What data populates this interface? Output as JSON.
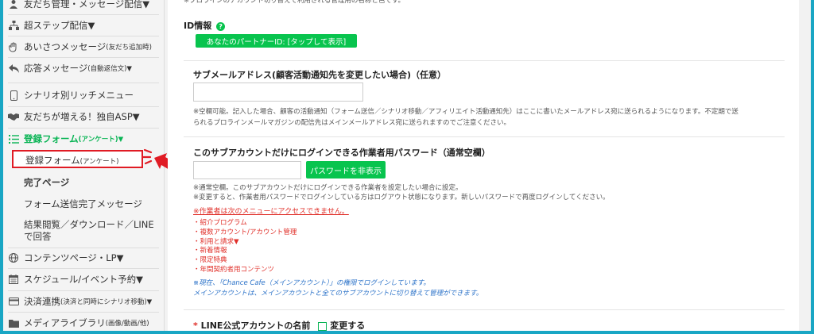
{
  "sidebar": {
    "items": [
      {
        "label": "友だち管理・メッセージ配信▼",
        "icon": "person-icon"
      },
      {
        "label": "超ステップ配信▼",
        "icon": "sitemap-icon"
      },
      {
        "label": "あいさつメッセージ",
        "small": "(友だち追加時)",
        "icon": "hand-icon"
      },
      {
        "label": "応答メッセージ",
        "small": "(自動返信文)▼",
        "icon": "reply-icon"
      },
      {
        "label": "シナリオ別リッチメニュー",
        "icon": "mobile-icon"
      },
      {
        "label": "友だちが増える！独自ASP▼",
        "icon": "handshake-icon"
      },
      {
        "label": "登録フォーム",
        "small": "(アンケート)▼",
        "icon": "list-icon"
      }
    ],
    "sub_items": [
      {
        "label": "登録フォーム",
        "small": "(アンケート)"
      },
      {
        "label": "完了ページ"
      },
      {
        "label": "フォーム送信完了メッセージ"
      },
      {
        "label_line1": "結果閲覧／ダウンロード／LINE",
        "label_line2": "で回答"
      }
    ],
    "bottom_items": [
      {
        "label": "コンテンツページ・LP▼",
        "icon": "globe-icon"
      },
      {
        "label": "スケジュール/イベント予約▼",
        "icon": "calendar-icon"
      },
      {
        "label": "決済連携",
        "small": "(決済と同時にシナリオ移動)▼",
        "icon": "card-icon"
      },
      {
        "label": "メディアライブラリ",
        "small": "(画像/動画/他)",
        "icon": "folder-icon"
      }
    ]
  },
  "content": {
    "top_note": "※プロラインのアカウント切り替えで利用される管理用の名称と色です。",
    "id_section": {
      "title": "ID情報",
      "help_icon": "question-icon",
      "button": "あなたのパートナーID: [タップして表示]"
    },
    "sub_email": {
      "title": "サブメールアドレス(顧客活動通知先を変更したい場合)（任意）",
      "note_line1": "※空欄可能。記入した場合、顧客の活動通知（フォーム送信／シナリオ移動／アフィリエイト活動通知先）はここに書いたメールアドレス宛に送られるようになります。不定期で送",
      "note_line2": "られるプロラインメールマガジンの配信先はメインメールアドレス宛に送られますのでご注意ください。"
    },
    "password": {
      "title": "このサブアカウントだけにログインできる作業者用パスワード（通常空欄）",
      "hide_button": "パスワードを非表示",
      "note_line1": "※通常空欄。このサブアカウントだけにログインできる作業者を設定したい場合に設定。",
      "note_line2": "※変更すると、作業者用パスワードでログインしている方はログアウト状態になります。新しいパスワードで再度ログインしてください。",
      "warning": "※作業者は次のメニューにアクセスできません。",
      "restricted": [
        "・紹介プログラム",
        "・複数アカウント/アカウント管理",
        "・利用と請求▼",
        "・新着情報",
        "・限定特典",
        "・年間契約者用コンテンツ"
      ],
      "blue_line1": "※現在、「Chance Cafe（メインアカウント）」の権限でログインしています。",
      "blue_line2": "メインアカウントは、メインアカウントと全てのサブアカウントに切り替えて管理ができます。"
    },
    "line_name": {
      "required_mark": "*",
      "title": "LINE公式アカウントの名前",
      "change_label": "変更する"
    }
  },
  "colors": {
    "frame": "#19a6c4",
    "accent_green": "#08c44e",
    "warning_red": "#e0302a",
    "note_blue": "#2e74c9",
    "highlight_red": "#e01b24"
  }
}
